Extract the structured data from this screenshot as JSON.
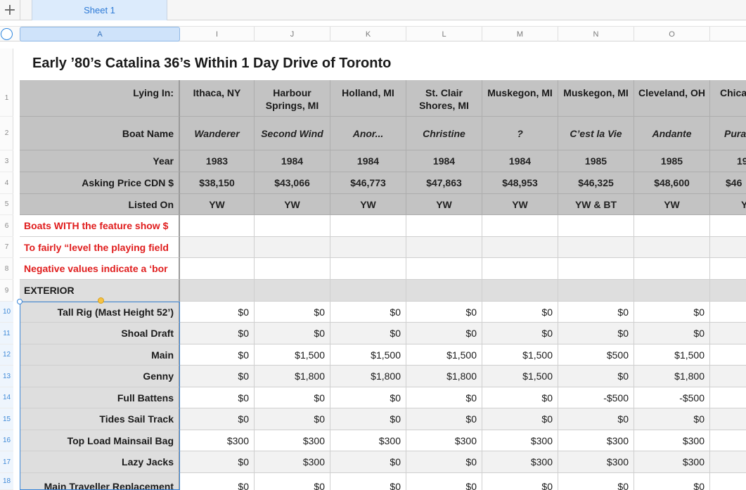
{
  "tabs": {
    "add_label": "+",
    "sheet_name": "Sheet 1"
  },
  "columns": [
    "A",
    "I",
    "J",
    "K",
    "L",
    "M",
    "N",
    "O",
    ""
  ],
  "row_numbers": [
    "1",
    "2",
    "3",
    "4",
    "5",
    "6",
    "7",
    "8",
    "9",
    "10",
    "11",
    "12",
    "13",
    "14",
    "15",
    "16",
    "17",
    "18"
  ],
  "title": "Early ’80’s Catalina 36’s Within 1 Day Drive of Toronto",
  "header_rows": {
    "lying_in": {
      "label": "Lying In:",
      "values": [
        "Ithaca, NY",
        "Harbour Springs, MI",
        "Holland, MI",
        "St. Clair Shores, MI",
        "Muskegon, MI",
        "Muskegon, MI",
        "Cleveland, OH",
        "Chica"
      ]
    },
    "boat_name": {
      "label": "Boat Name",
      "values": [
        "Wanderer",
        "Second Wind",
        "Anor...",
        "Christine",
        "?",
        "C’est la Vie",
        "Andante",
        "Pura"
      ]
    },
    "year": {
      "label": "Year",
      "values": [
        "1983",
        "1984",
        "1984",
        "1984",
        "1984",
        "1985",
        "1985",
        "19"
      ]
    },
    "asking_price": {
      "label": "Asking Price CDN $",
      "values": [
        "$38,150",
        "$43,066",
        "$46,773",
        "$47,863",
        "$48,953",
        "$46,325",
        "$48,600",
        "$46"
      ]
    },
    "listed_on": {
      "label": "Listed On",
      "values": [
        "YW",
        "YW",
        "YW",
        "YW",
        "YW",
        "YW & BT",
        "YW",
        "Y"
      ]
    }
  },
  "notes": [
    "Boats WITH the feature show $",
    "To fairly “level the playing field",
    "Negative values indicate a ‘bor"
  ],
  "section": "EXTERIOR",
  "feature_rows": [
    {
      "label": "Tall Rig (Mast Height 52’)",
      "values": [
        "$0",
        "$0",
        "$0",
        "$0",
        "$0",
        "$0",
        "$0"
      ]
    },
    {
      "label": "Shoal Draft",
      "values": [
        "$0",
        "$0",
        "$0",
        "$0",
        "$0",
        "$0",
        "$0"
      ]
    },
    {
      "label": "Main",
      "values": [
        "$0",
        "$1,500",
        "$1,500",
        "$1,500",
        "$1,500",
        "$500",
        "$1,500"
      ]
    },
    {
      "label": "Genny",
      "values": [
        "$0",
        "$1,800",
        "$1,800",
        "$1,800",
        "$1,500",
        "$0",
        "$1,800"
      ]
    },
    {
      "label": "Full Battens",
      "values": [
        "$0",
        "$0",
        "$0",
        "$0",
        "$0",
        "-$500",
        "-$500"
      ]
    },
    {
      "label": "Tides Sail Track",
      "values": [
        "$0",
        "$0",
        "$0",
        "$0",
        "$0",
        "$0",
        "$0"
      ]
    },
    {
      "label": "Top Load Mainsail Bag",
      "values": [
        "$300",
        "$300",
        "$300",
        "$300",
        "$300",
        "$300",
        "$300"
      ]
    },
    {
      "label": "Lazy Jacks",
      "values": [
        "$0",
        "$300",
        "$0",
        "$0",
        "$300",
        "$300",
        "$300"
      ]
    },
    {
      "label": "Main Traveller Replacement",
      "values": [
        "$0",
        "$0",
        "$0",
        "$0",
        "$0",
        "$0",
        "$0"
      ]
    }
  ]
}
